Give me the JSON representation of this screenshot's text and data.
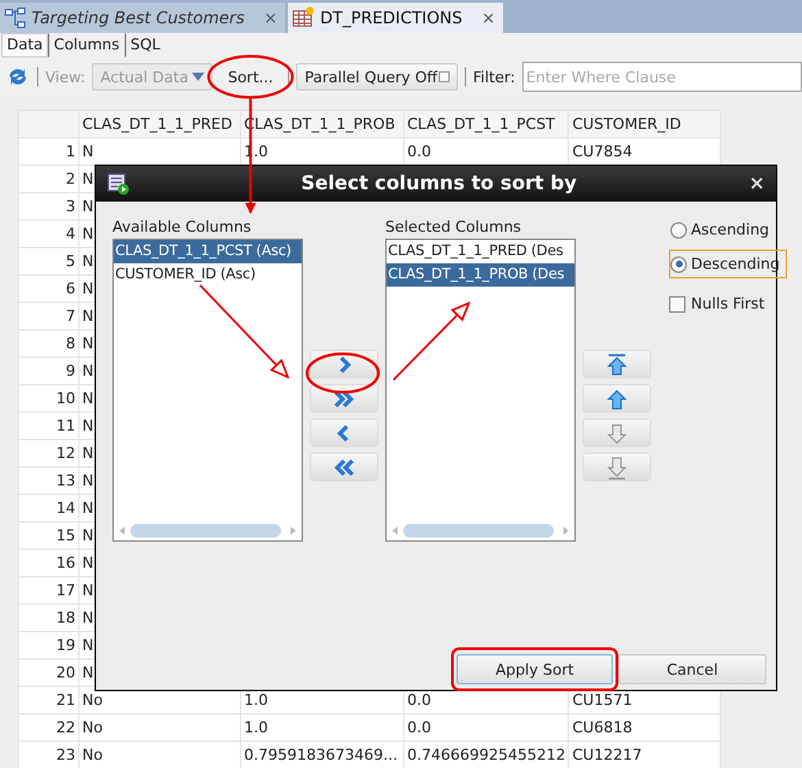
{
  "editor_tabs": [
    {
      "label": "Targeting Best Customers",
      "kind": "workflow",
      "selected": false,
      "close": "×"
    },
    {
      "label": "DT_PREDICTIONS",
      "kind": "table",
      "selected": true,
      "close": "×"
    }
  ],
  "sub_tabs": [
    {
      "label": "Data",
      "selected": true
    },
    {
      "label": "Columns",
      "selected": false
    },
    {
      "label": "SQL",
      "selected": false
    }
  ],
  "toolbar": {
    "view_label": "View:",
    "view_value": "Actual Data",
    "view_disabled": true,
    "sort_button": "Sort...",
    "parallel_button": "Parallel Query Off",
    "filter_label": "Filter:",
    "filter_placeholder": "Enter Where Clause"
  },
  "table": {
    "columns": [
      "CLAS_DT_1_1_PRED",
      "CLAS_DT_1_1_PROB",
      "CLAS_DT_1_1_PCST",
      "CUSTOMER_ID"
    ],
    "rows": [
      {
        "number": "1",
        "cells": [
          "N",
          "1.0",
          "0.0",
          "CU7854"
        ]
      },
      {
        "number": "2",
        "cells": [
          "N"
        ]
      },
      {
        "number": "3",
        "cells": [
          "N"
        ]
      },
      {
        "number": "4",
        "cells": [
          "N"
        ]
      },
      {
        "number": "5",
        "cells": [
          "N"
        ]
      },
      {
        "number": "6",
        "cells": [
          "N"
        ]
      },
      {
        "number": "7",
        "cells": [
          "N"
        ]
      },
      {
        "number": "8",
        "cells": [
          "N"
        ]
      },
      {
        "number": "9",
        "cells": [
          "N"
        ]
      },
      {
        "number": "10",
        "cells": [
          "N"
        ]
      },
      {
        "number": "11",
        "cells": [
          "N"
        ]
      },
      {
        "number": "12",
        "cells": [
          "N"
        ]
      },
      {
        "number": "13",
        "cells": [
          "N"
        ]
      },
      {
        "number": "14",
        "cells": [
          "N"
        ]
      },
      {
        "number": "15",
        "cells": [
          "N"
        ]
      },
      {
        "number": "16",
        "cells": [
          "N"
        ]
      },
      {
        "number": "17",
        "cells": [
          "N"
        ]
      },
      {
        "number": "18",
        "cells": [
          "N"
        ]
      },
      {
        "number": "19",
        "cells": [
          "N"
        ]
      },
      {
        "number": "20",
        "cells": [
          "N"
        ]
      },
      {
        "number": "21",
        "cells": [
          "No",
          "1.0",
          "0.0",
          "CU1571"
        ]
      },
      {
        "number": "22",
        "cells": [
          "No",
          "1.0",
          "0.0",
          "CU6818"
        ]
      },
      {
        "number": "23",
        "cells": [
          "No",
          "0.7959183673469...",
          "0.746669925455212",
          "CU12217"
        ]
      }
    ]
  },
  "dialog": {
    "title": "Select columns to sort by",
    "close": "×",
    "available": {
      "label": "Available Columns",
      "items": [
        {
          "text": "CLAS_DT_1_1_PCST (Asc)",
          "selected": true
        },
        {
          "text": "CUSTOMER_ID (Asc)",
          "selected": false
        }
      ]
    },
    "chosen": {
      "label": "Selected Columns",
      "items": [
        {
          "text": "CLAS_DT_1_1_PRED (Des",
          "selected": false
        },
        {
          "text": "CLAS_DT_1_1_PROB (Des",
          "selected": true
        }
      ]
    },
    "move_buttons": [
      {
        "kind": "add"
      },
      {
        "kind": "add-all"
      },
      {
        "kind": "remove"
      },
      {
        "kind": "remove-all"
      }
    ],
    "order_buttons": [
      {
        "kind": "top",
        "disabled": false
      },
      {
        "kind": "up",
        "disabled": false
      },
      {
        "kind": "down",
        "disabled": true
      },
      {
        "kind": "bottom",
        "disabled": true
      }
    ],
    "order_options": [
      {
        "label": "Ascending",
        "selected": false,
        "focused": false
      },
      {
        "label": "Descending",
        "selected": true,
        "focused": true
      }
    ],
    "nulls_first": {
      "label": "Nulls First",
      "checked": false
    },
    "buttons": [
      {
        "label": "Apply Sort",
        "kind": "default"
      },
      {
        "label": "Cancel",
        "kind": "normal"
      }
    ]
  }
}
